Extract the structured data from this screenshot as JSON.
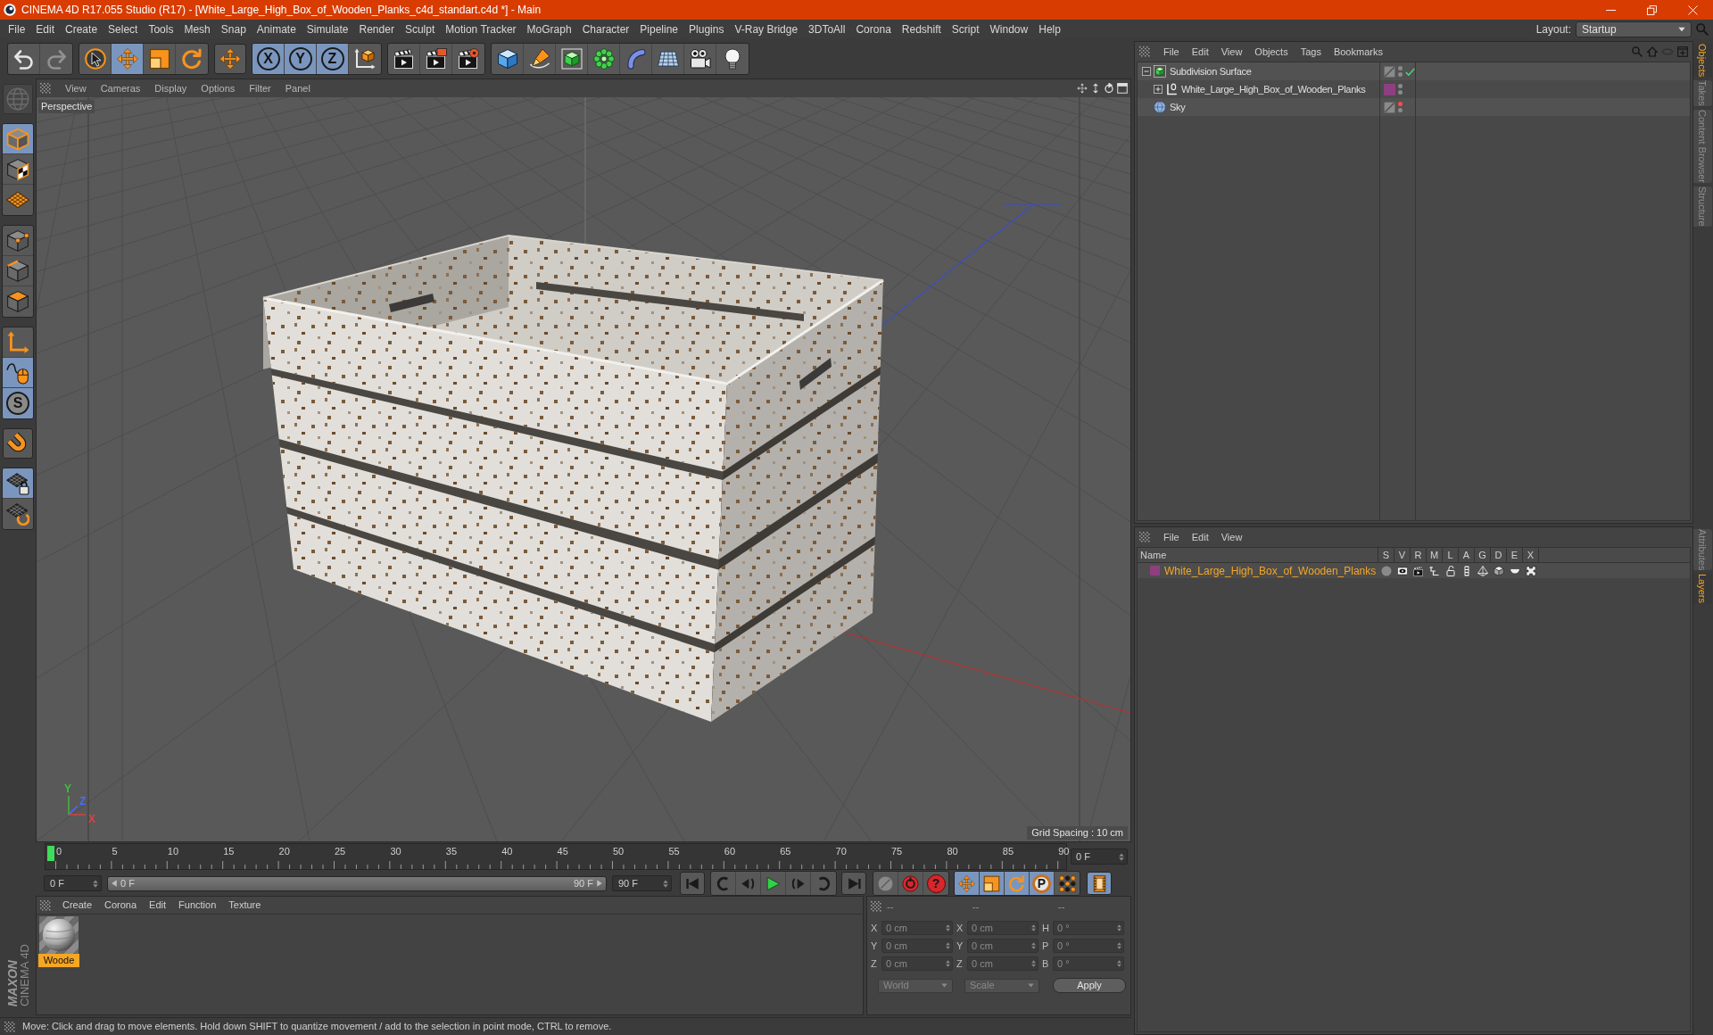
{
  "window": {
    "title": "CINEMA 4D R17.055 Studio (R17) - [White_Large_High_Box_of_Wooden_Planks_c4d_standart.c4d *] - Main"
  },
  "menu_bar": {
    "items": [
      "File",
      "Edit",
      "Create",
      "Select",
      "Tools",
      "Mesh",
      "Snap",
      "Animate",
      "Simulate",
      "Render",
      "Sculpt",
      "Motion Tracker",
      "MoGraph",
      "Character",
      "Pipeline",
      "Plugins",
      "V-Ray Bridge",
      "3DToAll",
      "Corona",
      "Redshift",
      "Script",
      "Window",
      "Help"
    ],
    "layout_label": "Layout:",
    "layout_value": "Startup"
  },
  "toolbar": {
    "groups": [
      {
        "tools": [
          {
            "kind": "undo",
            "active": false,
            "disabled": false
          },
          {
            "kind": "redo",
            "active": false,
            "disabled": true
          }
        ]
      },
      {
        "tools": [
          {
            "kind": "select",
            "active": false,
            "disabled": false
          },
          {
            "kind": "move",
            "active": true,
            "disabled": false
          },
          {
            "kind": "scale",
            "active": false,
            "disabled": false
          },
          {
            "kind": "rotate",
            "active": false,
            "disabled": false
          }
        ]
      },
      {
        "tools": [
          {
            "kind": "last-tool",
            "active": false,
            "disabled": false
          }
        ]
      },
      {
        "tools": [
          {
            "kind": "lock-x",
            "label": "X",
            "active": true,
            "disabled": false
          },
          {
            "kind": "lock-y",
            "label": "Y",
            "active": true,
            "disabled": false
          },
          {
            "kind": "lock-z",
            "label": "Z",
            "active": true,
            "disabled": false
          },
          {
            "kind": "coordinate-system",
            "active": false,
            "disabled": false
          }
        ]
      },
      {
        "tools": [
          {
            "kind": "render-view",
            "active": false,
            "disabled": false
          },
          {
            "kind": "render-picture-viewer",
            "active": false,
            "disabled": false
          },
          {
            "kind": "render-settings",
            "active": false,
            "disabled": false
          }
        ]
      },
      {
        "tools": [
          {
            "kind": "cube",
            "active": false,
            "disabled": false
          },
          {
            "kind": "pen",
            "active": false,
            "disabled": false
          },
          {
            "kind": "subdivision",
            "active": false,
            "disabled": false
          },
          {
            "kind": "array",
            "active": false,
            "disabled": false
          },
          {
            "kind": "bend",
            "active": false,
            "disabled": false
          },
          {
            "kind": "floor",
            "active": false,
            "disabled": false
          },
          {
            "kind": "camera",
            "active": false,
            "disabled": false
          },
          {
            "kind": "light",
            "active": false,
            "disabled": false
          }
        ]
      }
    ]
  },
  "left_toolbar": {
    "groups": [
      {
        "tools": [
          {
            "kind": "make-editable",
            "active": false,
            "disabled": true
          }
        ]
      },
      {
        "tools": [
          {
            "kind": "model",
            "active": true,
            "disabled": false
          },
          {
            "kind": "texture",
            "active": false,
            "disabled": false
          },
          {
            "kind": "workplane",
            "active": false,
            "disabled": false
          }
        ]
      },
      {
        "tools": [
          {
            "kind": "points",
            "active": false,
            "disabled": false
          },
          {
            "kind": "edges",
            "active": false,
            "disabled": false
          },
          {
            "kind": "polygons",
            "active": false,
            "disabled": false
          }
        ]
      },
      {
        "tools": [
          {
            "kind": "axis",
            "active": false,
            "disabled": false
          },
          {
            "kind": "tweak",
            "active": true,
            "disabled": false
          },
          {
            "kind": "snap",
            "label": "S",
            "active": true,
            "disabled": false
          }
        ]
      },
      {
        "tools": [
          {
            "kind": "magnet",
            "active": false,
            "disabled": false
          }
        ]
      },
      {
        "tools": [
          {
            "kind": "workplane-lock",
            "active": true,
            "disabled": false
          },
          {
            "kind": "workplane-rotate",
            "active": false,
            "disabled": false
          }
        ]
      }
    ]
  },
  "logo": {
    "brand": "MAXON",
    "product": "CINEMA 4D"
  },
  "viewport": {
    "menu": [
      "View",
      "Cameras",
      "Display",
      "Options",
      "Filter",
      "Panel"
    ],
    "camera": "Perspective",
    "grid_spacing": "Grid Spacing : 10 cm",
    "axis_labels": [
      {
        "text": "Y",
        "color": "#3fbf3f"
      },
      {
        "text": "Z",
        "color": "#4a6cff"
      },
      {
        "text": "X",
        "color": "#e04040"
      }
    ]
  },
  "timeline": {
    "ticks": [
      "0",
      "5",
      "10",
      "15",
      "20",
      "25",
      "30",
      "35",
      "40",
      "45",
      "50",
      "55",
      "60",
      "65",
      "70",
      "75",
      "80",
      "85",
      "90"
    ],
    "playhead": {
      "level": 0
    },
    "current_frame": "0 F"
  },
  "transport": {
    "start": "0 F",
    "range": {
      "start": "0 F",
      "end": "90 F"
    },
    "end": "90 F",
    "groups": [
      {
        "tools": [
          {
            "kind": "go-start",
            "active": false
          }
        ]
      },
      {
        "tools": [
          {
            "kind": "prev-key",
            "active": false
          },
          {
            "kind": "prev-frame",
            "active": false
          },
          {
            "kind": "play",
            "active": false
          },
          {
            "kind": "next-frame",
            "active": false
          },
          {
            "kind": "next-key",
            "active": false
          }
        ]
      },
      {
        "tools": [
          {
            "kind": "go-end",
            "active": false
          }
        ]
      },
      {
        "tools": [
          {
            "kind": "record",
            "active": false
          },
          {
            "kind": "autokey",
            "active": false
          },
          {
            "kind": "keyframe-selection",
            "label": "?",
            "active": false
          }
        ]
      },
      {
        "tools": [
          {
            "kind": "position-key",
            "active": true
          },
          {
            "kind": "scale-key",
            "active": true
          },
          {
            "kind": "rotation-key",
            "active": true
          },
          {
            "kind": "parameter-key",
            "label": "P",
            "active": true
          },
          {
            "kind": "point-level-key",
            "active": false
          }
        ]
      },
      {
        "tools": [
          {
            "kind": "timeline",
            "active": true
          }
        ]
      }
    ]
  },
  "material_manager": {
    "menu": [
      "Create",
      "Corona",
      "Edit",
      "Function",
      "Texture"
    ],
    "materials": [
      {
        "name": "Woode",
        "selected": true
      }
    ]
  },
  "coordinates": {
    "headers": [
      "--",
      "--",
      "--"
    ],
    "rows": [
      {
        "position_axis": "X",
        "position": "0 cm",
        "size_axis": "X",
        "size": "0 cm",
        "rotation_axis": "H",
        "rotation": "0 °"
      },
      {
        "position_axis": "Y",
        "position": "0 cm",
        "size_axis": "Y",
        "size": "0 cm",
        "rotation_axis": "P",
        "rotation": "0 °"
      },
      {
        "position_axis": "Z",
        "position": "0 cm",
        "size_axis": "Z",
        "size": "0 cm",
        "rotation_axis": "B",
        "rotation": "0 °"
      }
    ],
    "position_mode": "World",
    "size_mode": "Scale",
    "apply": "Apply"
  },
  "status_bar": {
    "text": "Move: Click and drag to move elements. Hold down SHIFT to quantize movement / add to the selection in point mode, CTRL to remove."
  },
  "object_manager": {
    "menu": [
      "File",
      "Edit",
      "View",
      "Objects",
      "Tags",
      "Bookmarks"
    ],
    "objects": [
      {
        "name": "Subdivision Surface",
        "kind": "subdivision",
        "expanded": true,
        "enabled": true,
        "editor_hidden": false,
        "render_hidden": false,
        "children": [
          {
            "name": "White_Large_High_Box_of_Wooden_Planks",
            "kind": "null",
            "expanded": false,
            "color": "#8e3f80",
            "editor_hidden": false,
            "render_hidden": false
          }
        ]
      },
      {
        "name": "Sky",
        "kind": "sky",
        "editor_hidden": true,
        "render_hidden": false
      }
    ]
  },
  "layer_manager": {
    "menu": [
      "File",
      "Edit",
      "View"
    ],
    "columns": [
      "Name",
      "S",
      "V",
      "R",
      "M",
      "L",
      "A",
      "G",
      "D",
      "E",
      "X"
    ],
    "layers": [
      {
        "name": "White_Large_High_Box_of_Wooden_Planks",
        "color": "#8e3f80",
        "selected": true
      }
    ]
  },
  "side_tabs": {
    "top": [
      {
        "label": "Objects",
        "selected": true
      },
      {
        "label": "Takes",
        "selected": false
      },
      {
        "label": "Content Browser",
        "selected": false
      },
      {
        "label": "Structure",
        "selected": false
      }
    ],
    "bottom": [
      {
        "label": "Attributes",
        "selected": false
      },
      {
        "label": "Layers",
        "selected": true
      }
    ]
  }
}
